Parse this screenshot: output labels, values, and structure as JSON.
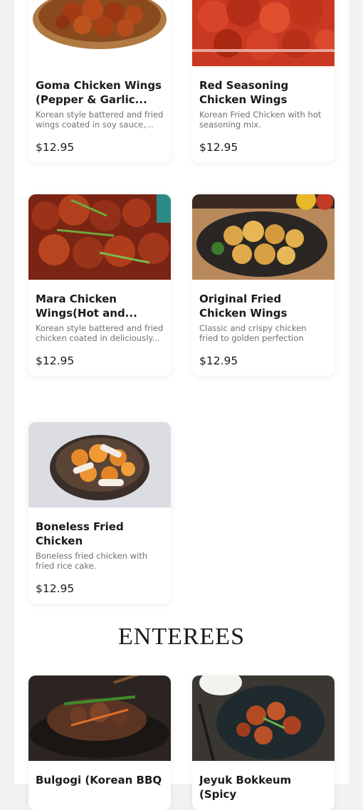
{
  "menu_items": [
    {
      "name": "Goma Chicken Wings (Pepper & Garlic...",
      "description": "Korean style battered and fried wings coated in soy sauce,...",
      "price": "$12.95"
    },
    {
      "name": "Red Seasoning Chicken Wings",
      "description": "Korean Fried Chicken with hot seasoning mix.",
      "price": "$12.95"
    },
    {
      "name": "Mara Chicken Wings(Hot and...",
      "description": "Korean style battered and fried chicken coated in deliciously...",
      "price": "$12.95"
    },
    {
      "name": "Original Fried Chicken Wings",
      "description": "Classic and crispy chicken fried to golden perfection",
      "price": "$12.95"
    },
    {
      "name": "Boneless Fried Chicken",
      "description": "Boneless fried chicken with fried rice cake.",
      "price": "$12.95"
    }
  ],
  "section": {
    "title": "ENTEREES"
  },
  "enterees": [
    {
      "name": "Bulgogi (Korean BBQ"
    },
    {
      "name": "Jeyuk Bokkeum (Spicy"
    }
  ]
}
